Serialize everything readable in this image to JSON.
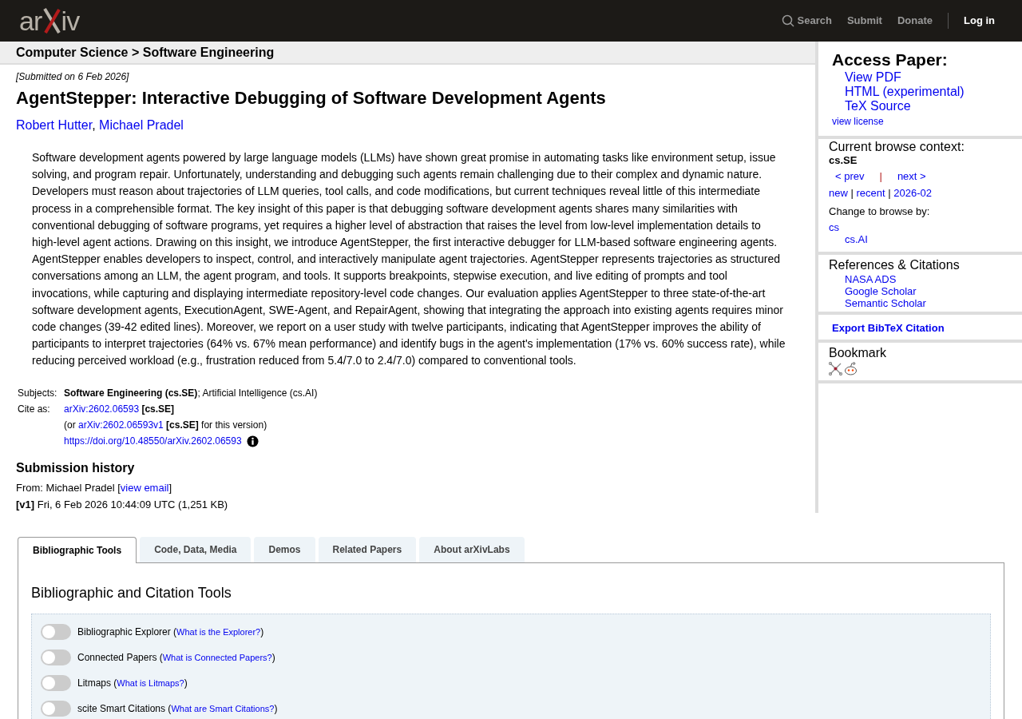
{
  "header": {
    "logo": {
      "left": "ar",
      "right": "iv"
    },
    "nav": [
      {
        "label": "Search",
        "kind": "search"
      },
      {
        "label": "Submit",
        "kind": "link"
      },
      {
        "label": "Donate",
        "kind": "link"
      },
      {
        "label": "Log in",
        "kind": "login"
      }
    ]
  },
  "breadcrumb": "Computer Science > Software Engineering",
  "submitted": "[Submitted on 6 Feb 2026]",
  "title": "AgentStepper: Interactive Debugging of Software Development Agents",
  "authors": [
    "Robert Hutter",
    "Michael Pradel"
  ],
  "author_separator": ", ",
  "abstract": "Software development agents powered by large language models (LLMs) have shown great promise in automating tasks like environment setup, issue solving, and program repair. Unfortunately, understanding and debugging such agents remain challenging due to their complex and dynamic nature. Developers must reason about trajectories of LLM queries, tool calls, and code modifications, but current techniques reveal little of this intermediate process in a comprehensible format. The key insight of this paper is that debugging software development agents shares many similarities with conventional debugging of software programs, yet requires a higher level of abstraction that raises the level from low-level implementation details to high-level agent actions. Drawing on this insight, we introduce AgentStepper, the first interactive debugger for LLM-based software engineering agents. AgentStepper enables developers to inspect, control, and interactively manipulate agent trajectories. AgentStepper represents trajectories as structured conversations among an LLM, the agent program, and tools. It supports breakpoints, stepwise execution, and live editing of prompts and tool invocations, while capturing and displaying intermediate repository-level code changes. Our evaluation applies AgentStepper to three state-of-the-art software development agents, ExecutionAgent, SWE-Agent, and RepairAgent, showing that integrating the approach into existing agents requires minor code changes (39-42 edited lines). Moreover, we report on a user study with twelve participants, indicating that AgentStepper improves the ability of participants to interpret trajectories (64% vs. 67% mean performance) and identify bugs in the agent's implementation (17% vs. 60% success rate), while reducing perceived workload (e.g., frustration reduced from 5.4/7.0 to 2.4/7.0) compared to conventional tools.",
  "metadata": {
    "subjects_label": "Subjects:",
    "subjects": "**Software Engineering (cs.SE)**; Artificial Intelligence (cs.AI)",
    "cite_label": "Cite as:",
    "cite_rows": [
      {
        "before": "",
        "link": "arXiv:2602.06593",
        "bold": " [cs.SE]",
        "after": ""
      },
      {
        "before": "(or ",
        "link": "arXiv:2602.06593v1",
        "bold": " [cs.SE]",
        "after": " for this version)"
      }
    ],
    "doi": "https://doi.org/10.48550/arXiv.2602.06593"
  },
  "history": {
    "title": "Submission history",
    "from_before": "From: Michael Pradel [",
    "from_link": "view email",
    "from_after": "]",
    "versions": [
      "**[v1]** Fri, 6 Feb 2026 10:44:09 UTC (1,251 KB)"
    ]
  },
  "sidebar": {
    "access": {
      "title": "Access Paper:",
      "links": [
        "View PDF",
        "HTML (experimental)",
        "TeX Source"
      ],
      "license": "view license"
    },
    "browse": {
      "title": "Current browse context:",
      "context": "cs.SE",
      "prev": "< prev",
      "separator": "|",
      "next": "next >",
      "lists": [
        {
          "label": "new",
          "sep": " | "
        },
        {
          "label": "recent",
          "sep": " | "
        },
        {
          "label": "2026-02"
        }
      ],
      "change_label": "Change to browse by:",
      "categories": [
        {
          "label": "cs",
          "children": [
            {
              "label": "cs.AI"
            }
          ]
        }
      ]
    },
    "references": {
      "title": "References & Citations",
      "links": [
        "NASA ADS",
        "Google Scholar",
        "Semantic Scholar"
      ]
    },
    "export": "Export BibTeX Citation",
    "bookmark": {
      "title": "Bookmark"
    }
  },
  "tabs": [
    {
      "label": "Bibliographic Tools",
      "selected": true
    },
    {
      "label": "Code, Data, Media",
      "selected": false
    },
    {
      "label": "Demos",
      "selected": false
    },
    {
      "label": "Related Papers",
      "selected": false
    },
    {
      "label": "About arXivLabs",
      "selected": false
    }
  ],
  "panel": {
    "title": "Bibliographic and Citation Tools",
    "tools": [
      {
        "label": "Bibliographic Explorer (",
        "link": "What is the Explorer?",
        "close": ")",
        "on": false
      },
      {
        "label": "Connected Papers (",
        "link": "What is Connected Papers?",
        "close": ")",
        "on": false
      },
      {
        "label": "Litmaps (",
        "link": "What is Litmaps?",
        "close": ")",
        "on": false
      },
      {
        "label": "scite Smart Citations (",
        "link": "What are Smart Citations?",
        "close": ")",
        "on": false
      }
    ]
  }
}
